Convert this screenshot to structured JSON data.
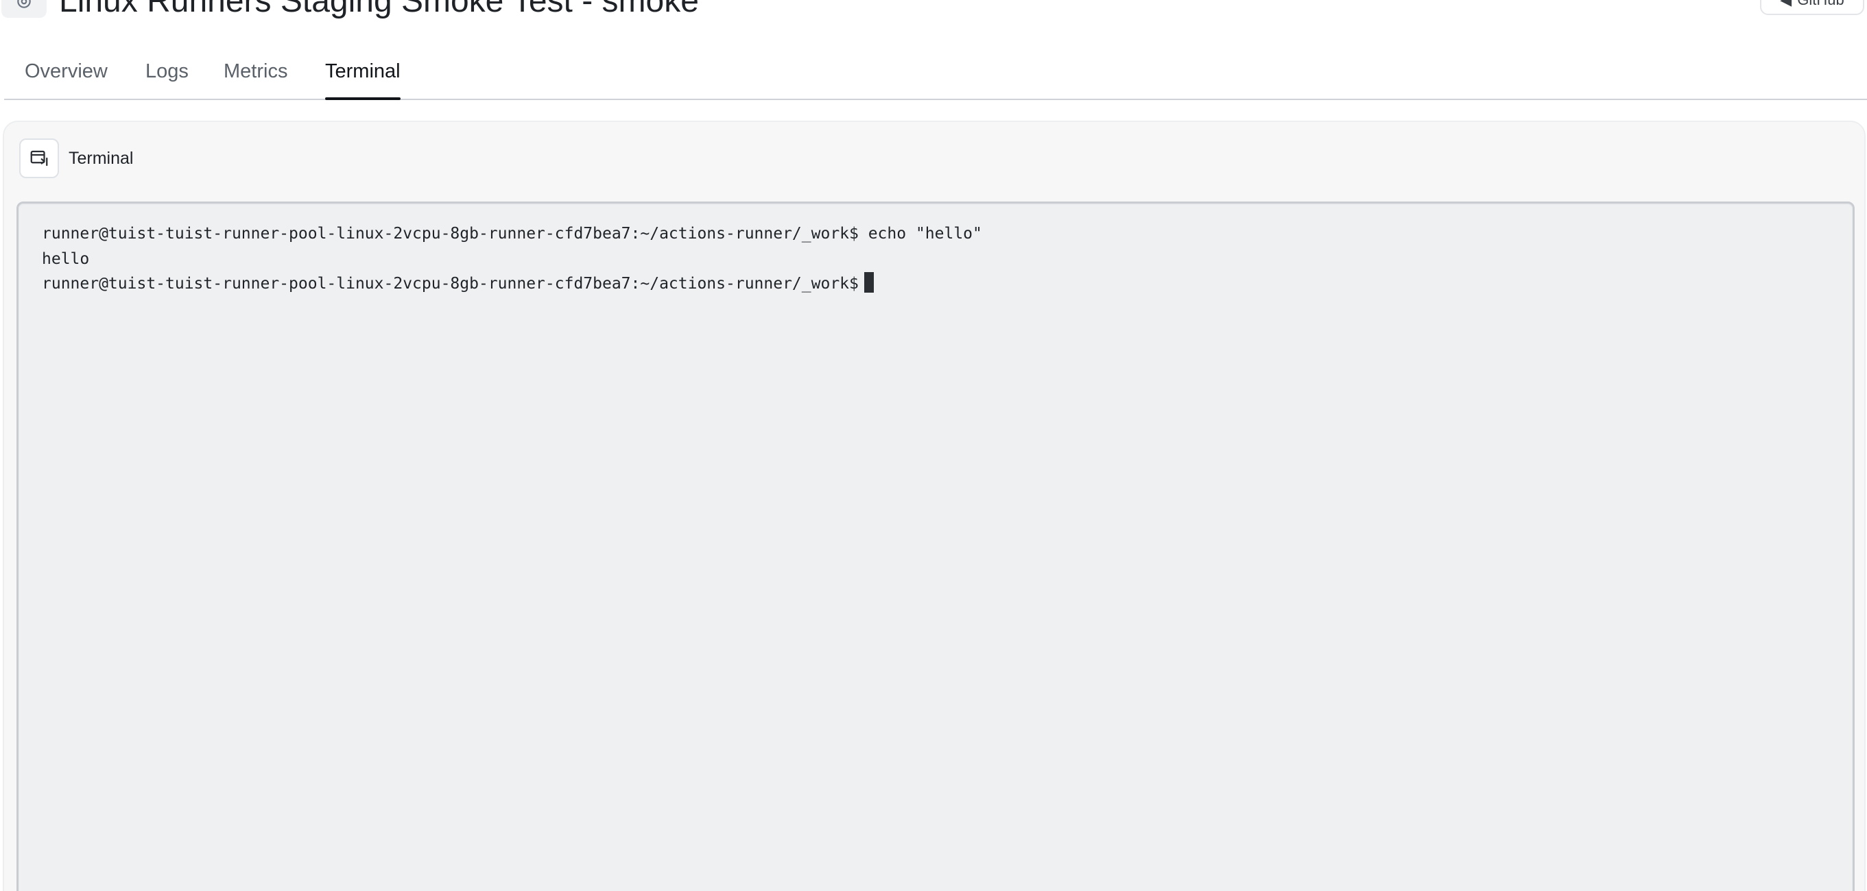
{
  "header": {
    "title": "Linux Runners Staging Smoke Test - smoke",
    "icon": "settings-icon",
    "action_label": "GitHub"
  },
  "tabs": [
    {
      "label": "Overview",
      "active": false
    },
    {
      "label": "Logs",
      "active": false
    },
    {
      "label": "Metrics",
      "active": false
    },
    {
      "label": "Terminal",
      "active": true
    }
  ],
  "panel": {
    "title": "Terminal",
    "icon": "terminal-window-icon"
  },
  "terminal": {
    "lines": [
      "runner@tuist-tuist-runner-pool-linux-2vcpu-8gb-runner-cfd7bea7:~/actions-runner/_work$ echo \"hello\"",
      "hello"
    ],
    "prompt": "runner@tuist-tuist-runner-pool-linux-2vcpu-8gb-runner-cfd7bea7:~/actions-runner/_work$"
  },
  "colors": {
    "terminal_bg": "#eff0f2",
    "panel_bg": "#f7f7f8",
    "active_tab": "#111418",
    "inactive_tab": "#5b6169"
  }
}
